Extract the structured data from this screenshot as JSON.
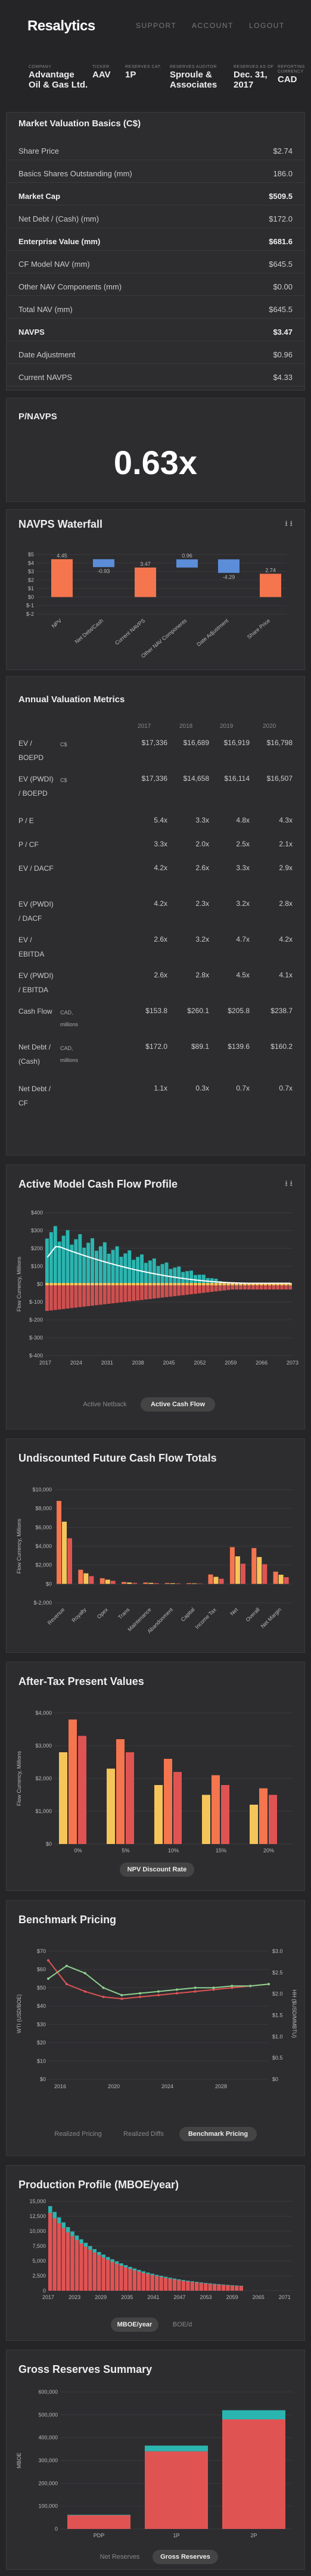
{
  "nav": {
    "logo": "Resalytics",
    "support": "SUPPORT",
    "account": "ACCOUNT",
    "logout": "LOGOUT"
  },
  "info": [
    {
      "label": "COMPANY",
      "value": "Advantage Oil & Gas Ltd."
    },
    {
      "label": "TICKER",
      "value": "AAV"
    },
    {
      "label": "RESERVES CAT.",
      "value": "1P"
    },
    {
      "label": "RESERVES AUDITOR",
      "value": "Sproule & Associates"
    },
    {
      "label": "RESERVES AS OF",
      "value": "Dec. 31, 2017"
    },
    {
      "label": "REPORTING CURRENCY",
      "value": "CAD"
    }
  ],
  "valuation": {
    "title": "Market Valuation Basics (C$)",
    "rows": [
      {
        "label": "Share Price",
        "value": "$2.74"
      },
      {
        "label": "Basics Shares Outstanding (mm)",
        "value": "186.0"
      },
      {
        "label": "Market Cap",
        "value": "$509.5",
        "bold": true
      },
      {
        "label": "Net Debt / (Cash) (mm)",
        "value": "$172.0"
      },
      {
        "label": "Enterprise Value (mm)",
        "value": "$681.6",
        "bold": true
      },
      {
        "label": "CF Model NAV (mm)",
        "value": "$645.5"
      },
      {
        "label": "Other NAV Components (mm)",
        "value": "$0.00"
      },
      {
        "label": "Total NAV (mm)",
        "value": "$645.5"
      },
      {
        "label": "NAVPS",
        "value": "$3.47",
        "bold": true
      },
      {
        "label": "Date Adjustment",
        "value": "$0.96"
      },
      {
        "label": "Current NAVPS",
        "value": "$4.33"
      }
    ]
  },
  "pnavps": {
    "title": "P/NAVPS",
    "value": "0.63x"
  },
  "waterfall": {
    "title": "NAVPS Waterfall",
    "chart_data": {
      "type": "bar",
      "categories": [
        "NPV",
        "Net Debt/Cash",
        "Current NAVPS",
        "Other NAV Components",
        "Date Adjustment",
        "Share Price"
      ],
      "values": [
        4.45,
        -0.93,
        3.47,
        0.96,
        -1.59,
        2.74
      ],
      "labels": [
        "4.45",
        "-0.93",
        "3.47",
        "0.96",
        "-4.29",
        "2.74"
      ],
      "ylim": [
        -2,
        5
      ],
      "yticks": [
        "$5",
        "$4",
        "$3",
        "$2",
        "$1",
        "$0",
        "$-1",
        "$-2"
      ]
    }
  },
  "annual": {
    "title": "Annual Valuation Metrics",
    "years": [
      "2017",
      "2018",
      "2019",
      "2020"
    ],
    "rows": [
      {
        "label": "EV / BOEPD",
        "unit": "C$",
        "values": [
          "$17,336",
          "$16,689",
          "$16,919",
          "$16,798"
        ]
      },
      {
        "label": "EV (PWDI) / BOEPD",
        "unit": "C$",
        "values": [
          "$17,336",
          "$14,658",
          "$16,114",
          "$16,507"
        ]
      },
      {
        "label": "P / E",
        "unit": "",
        "values": [
          "5.4x",
          "3.3x",
          "4.8x",
          "4.3x"
        ]
      },
      {
        "label": "P / CF",
        "unit": "",
        "values": [
          "3.3x",
          "2.0x",
          "2.5x",
          "2.1x"
        ]
      },
      {
        "label": "EV / DACF",
        "unit": "",
        "values": [
          "4.2x",
          "2.6x",
          "3.3x",
          "2.9x"
        ]
      },
      {
        "label": "EV (PWDI) / DACF",
        "unit": "",
        "values": [
          "4.2x",
          "2.3x",
          "3.2x",
          "2.8x"
        ]
      },
      {
        "label": "EV / EBITDA",
        "unit": "",
        "values": [
          "2.6x",
          "3.2x",
          "4.7x",
          "4.2x"
        ]
      },
      {
        "label": "EV (PWDI) / EBITDA",
        "unit": "",
        "values": [
          "2.6x",
          "2.8x",
          "4.5x",
          "4.1x"
        ]
      },
      {
        "label": "Cash Flow",
        "unit": "CAD, millions",
        "values": [
          "$153.8",
          "$260.1",
          "$205.8",
          "$238.7"
        ]
      },
      {
        "label": "Net Debt / (Cash)",
        "unit": "CAD, millions",
        "values": [
          "$172.0",
          "$89.1",
          "$139.6",
          "$160.2"
        ]
      },
      {
        "label": "Net Debt / CF",
        "unit": "",
        "values": [
          "1.1x",
          "0.3x",
          "0.7x",
          "0.7x"
        ]
      }
    ]
  },
  "cashflow": {
    "title": "Active Model Cash Flow Profile",
    "toggles": [
      "Active Netback",
      "Active Cash Flow"
    ],
    "chart_data": {
      "type": "bar",
      "ylabel": "Flow Currency, Millions",
      "x": [
        "2017",
        "2024",
        "2031",
        "2038",
        "2045",
        "2052",
        "2059",
        "2066",
        "2073"
      ],
      "ylim": [
        -400,
        400
      ],
      "yticks": [
        "$400",
        "$300",
        "$200",
        "$100",
        "$0",
        "$-100",
        "$-200",
        "$-300",
        "$-400"
      ],
      "bar_max": [
        340,
        330,
        320,
        305,
        285,
        265,
        240,
        215,
        185,
        155,
        125,
        95,
        70,
        45,
        25,
        10
      ],
      "line": [
        150,
        230,
        190,
        165,
        140,
        120,
        100,
        80,
        60,
        45,
        30,
        20,
        12,
        8,
        5,
        3
      ]
    }
  },
  "undisc": {
    "title": "Undiscounted Future Cash Flow Totals",
    "chart_data": {
      "type": "bar",
      "ylabel": "Flow Currency, Millions",
      "categories": [
        "Revenue",
        "Royalty",
        "Opex",
        "Trans",
        "Maintenance",
        "Abandonment",
        "Capital",
        "Income Tax",
        "Net",
        "Overall",
        "Net Margin"
      ],
      "yticks": [
        "$10,000",
        "$8,000",
        "$6,000",
        "$4,000",
        "$2,000",
        "$0",
        "$-2,000"
      ],
      "ylim": [
        -2000,
        10000
      ],
      "values": [
        8800,
        1500,
        600,
        200,
        150,
        100,
        80,
        1000,
        3900,
        3800,
        1300
      ]
    }
  },
  "aftertax": {
    "title": "After-Tax Present Values",
    "toggle": "NPV Discount Rate",
    "chart_data": {
      "type": "bar",
      "ylabel": "Flow Currency, Millions",
      "categories": [
        "0%",
        "5%",
        "10%",
        "15%",
        "20%"
      ],
      "yticks": [
        "$4,000",
        "$3,000",
        "$2,000",
        "$1,000",
        "$0"
      ],
      "ylim": [
        0,
        4000
      ],
      "series": [
        {
          "values": [
            2800,
            2300,
            1800,
            1500,
            1200
          ]
        },
        {
          "values": [
            3800,
            3200,
            2600,
            2100,
            1700
          ]
        },
        {
          "values": [
            3300,
            2800,
            2200,
            1800,
            1500
          ]
        }
      ]
    }
  },
  "benchmark": {
    "title": "Benchmark Pricing",
    "toggles": [
      "Realized Pricing",
      "Realized Diffs",
      "Benchmark Pricing"
    ],
    "chart_data": {
      "type": "line",
      "ylabel": "WTI (USD/BOE)",
      "ylabel2": "HH ($USD/MMBTU)",
      "x": [
        "2016",
        "2020",
        "2024",
        "2028"
      ],
      "yticks": [
        "$70",
        "$60",
        "$50",
        "$40",
        "$30",
        "$20",
        "$10",
        "$0"
      ],
      "yticks2": [
        "$3.0",
        "$2.5",
        "$2.0",
        "$1.5",
        "$1.0",
        "$0.5",
        "$0"
      ]
    }
  },
  "production": {
    "title": "Production Profile (MBOE/year)",
    "toggles": [
      "MBOE/year",
      "BOE/d"
    ],
    "chart_data": {
      "type": "bar",
      "x": [
        "2017",
        "2023",
        "2029",
        "2035",
        "2041",
        "2047",
        "2053",
        "2059",
        "2065",
        "2071"
      ],
      "yticks": [
        "15,000",
        "12,500",
        "10,000",
        "7,500",
        "5,000",
        "2,500",
        "0"
      ],
      "ylim": [
        0,
        15000
      ]
    }
  },
  "gross": {
    "title": "Gross Reserves Summary",
    "toggles": [
      "Net Reserves",
      "Gross Reserves"
    ],
    "chart_data": {
      "type": "bar",
      "ylabel": "MBOE",
      "categories": [
        "PDP",
        "1P",
        "2P"
      ],
      "yticks": [
        "600,000",
        "500,000",
        "400,000",
        "300,000",
        "200,000",
        "100,000",
        "0"
      ],
      "ylim": [
        0,
        600000
      ],
      "series": [
        {
          "name": "Gas",
          "values": [
            60000,
            340000,
            480000
          ]
        },
        {
          "name": "Liquids",
          "values": [
            2000,
            25000,
            40000
          ]
        }
      ]
    }
  },
  "colors": {
    "orange": "#f4754e",
    "blue": "#5b8dd9",
    "teal": "#2bb5b0",
    "red": "#e05353",
    "yellow": "#f5c55a"
  }
}
